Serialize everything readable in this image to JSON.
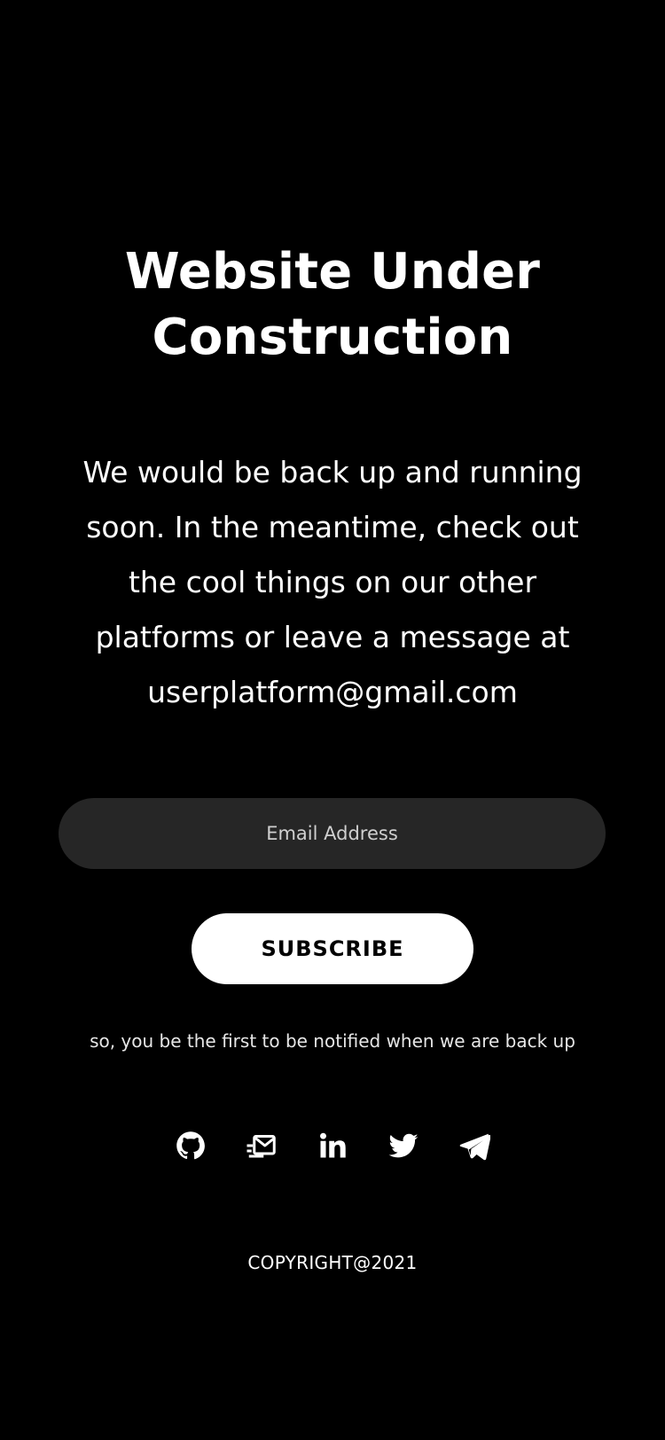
{
  "hero": {
    "title_line1": "Website Under",
    "title_line2": "Construction",
    "message": "We would be back up and running soon. In the meantime, check out the cool things on our other platforms or leave a message at userplatform@gmail.com"
  },
  "subscribe_form": {
    "email_placeholder": "Email Address",
    "email_value": "",
    "button_label": "SUBSCRIBE",
    "notice": "so, you be the first to be notified when we are back up"
  },
  "socials": [
    {
      "icon": "github-icon"
    },
    {
      "icon": "mail-icon"
    },
    {
      "icon": "linkedin-icon"
    },
    {
      "icon": "twitter-icon"
    },
    {
      "icon": "telegram-icon"
    }
  ],
  "footer": {
    "copyright": "COPYRIGHT@2021"
  },
  "colors": {
    "background": "#000000",
    "text": "#ffffff",
    "input_background": "#262626",
    "button_background": "#ffffff",
    "button_text": "#000000"
  }
}
